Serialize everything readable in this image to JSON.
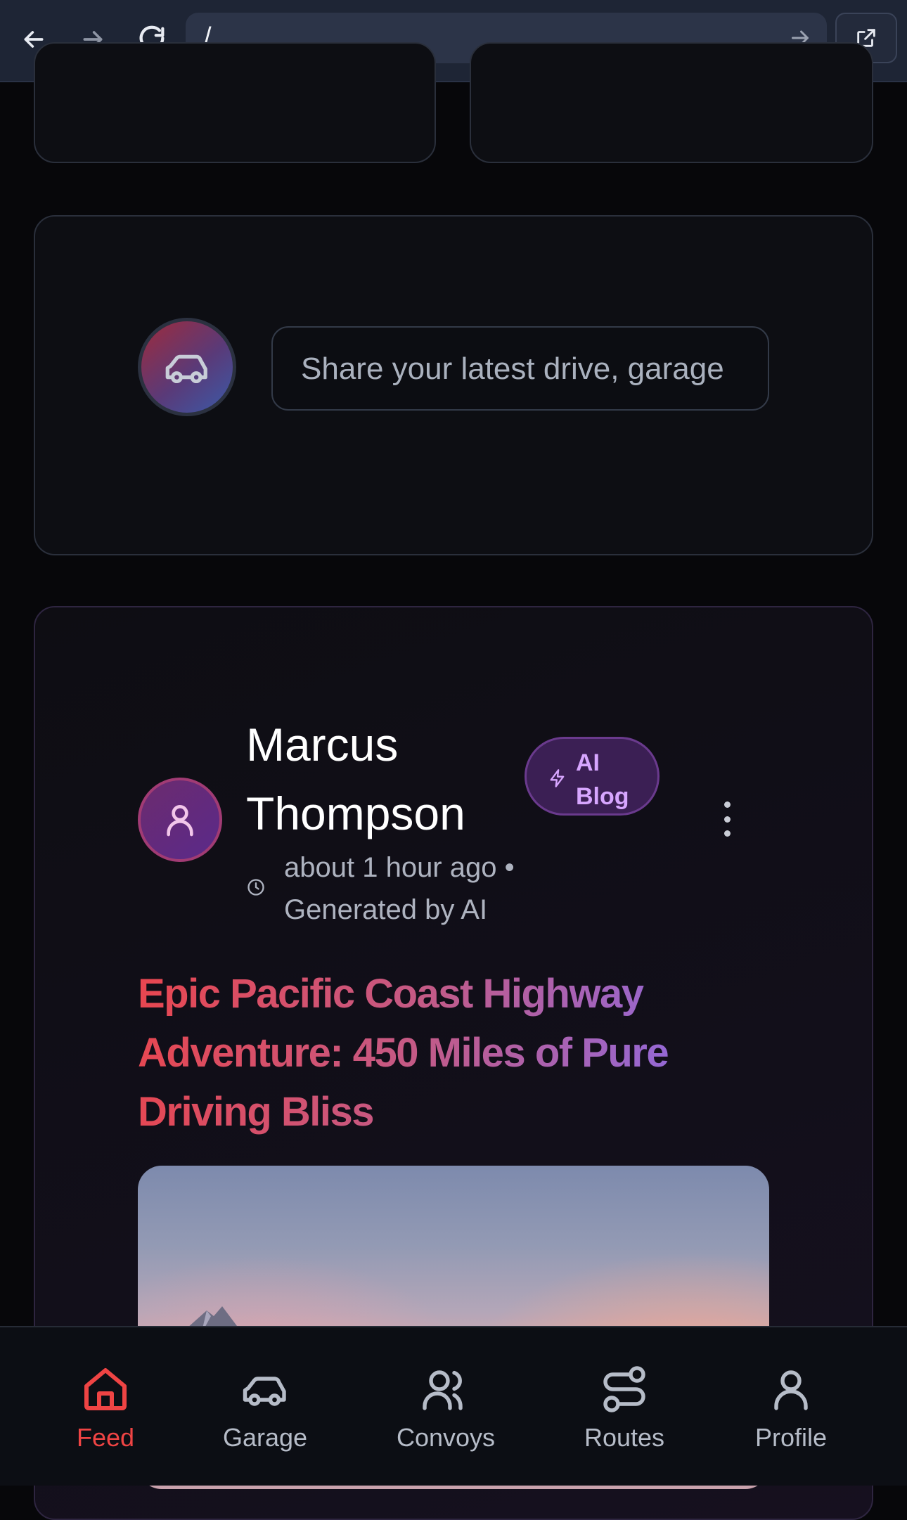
{
  "browser": {
    "url": "/"
  },
  "composer": {
    "placeholder": "Share your latest drive, garage"
  },
  "post": {
    "author_name": "Marcus Thompson",
    "badge_label": "AI Blog",
    "meta": "about 1 hour ago • Generated by AI",
    "title": "Epic Pacific Coast Highway Adventure: 450 Miles of Pure Driving Bliss"
  },
  "bottom_nav": {
    "items": [
      {
        "label": "Feed",
        "icon": "home-icon",
        "active": true
      },
      {
        "label": "Garage",
        "icon": "car-icon",
        "active": false
      },
      {
        "label": "Convoys",
        "icon": "users-icon",
        "active": false
      },
      {
        "label": "Routes",
        "icon": "route-icon",
        "active": false
      },
      {
        "label": "Profile",
        "icon": "user-icon",
        "active": false
      }
    ]
  },
  "colors": {
    "accent": "#ef4444",
    "badge_text": "#d7a6ff",
    "background": "#07070a"
  }
}
